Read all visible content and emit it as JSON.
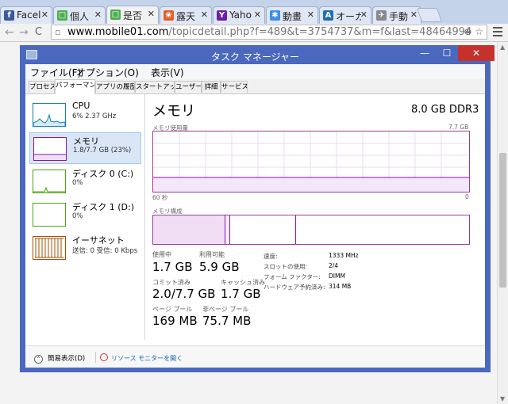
{
  "browser": {
    "tabs": [
      {
        "title": "Facel",
        "icon": "f",
        "color": "#3b5998"
      },
      {
        "title": "個人",
        "icon": "□",
        "color": "#4caf50"
      },
      {
        "title": "是否",
        "icon": "□",
        "color": "#4caf50"
      },
      {
        "title": "露天",
        "icon": "❀",
        "color": "#e0602a"
      },
      {
        "title": "Yaho",
        "icon": "Y",
        "color": "#6b1fa3"
      },
      {
        "title": "動畫",
        "icon": "✱",
        "color": "#3a8ee6"
      },
      {
        "title": "オーガ",
        "icon": "A",
        "color": "#1f6fb2"
      },
      {
        "title": "手動",
        "icon": "✈",
        "color": "#888888"
      }
    ],
    "close_glyph": "✕",
    "url_host": "www.mobile01.com",
    "url_path": "/topicdetail.php?f=489&t=3754737&m=f&last=48464994",
    "back_glyph": "←",
    "forward_glyph": "→",
    "reload_glyph": "C",
    "zoom_glyph": "⊕",
    "star_glyph": "☆",
    "page_glyph": "▫"
  },
  "taskmgr": {
    "title": "タスク マネージャー",
    "window_buttons": {
      "minimize": "—",
      "maximize": "☐",
      "close": "✕"
    },
    "menu": [
      "ファイル(F)",
      "オプション(O)",
      "表示(V)"
    ],
    "tabs": [
      "プロセス",
      "パフォーマンス",
      "アプリの履歴",
      "スタートアップ",
      "ユーザー",
      "詳細",
      "サービス"
    ],
    "resources": [
      {
        "name": "CPU",
        "sub": "6% 2.37 GHz",
        "color": "#117dbb"
      },
      {
        "name": "メモリ",
        "sub": "1.8/7.7 GB (23%)",
        "color": "#8b12ae"
      },
      {
        "name": "ディスク 0 (C:)",
        "sub": "0%",
        "color": "#4da60c"
      },
      {
        "name": "ディスク 1 (D:)",
        "sub": "0%",
        "color": "#4da60c"
      },
      {
        "name": "イーサネット",
        "sub": "送信: 0  受信: 0 Kbps",
        "color": "#a74f01"
      }
    ],
    "memory": {
      "title": "メモリ",
      "spec": "8.0 GB DDR3",
      "usage_label": "メモリ使用量",
      "usage_max": "7.7 GB",
      "axis_left": "60 秒",
      "axis_right": "0",
      "composition_label": "メモリ構成",
      "in_use_label": "使用中",
      "in_use": "1.7 GB",
      "available_label": "利用可能",
      "available": "5.9 GB",
      "committed_label": "コミット済み",
      "committed": "2.0/7.7 GB",
      "cached_label": "キャッシュ済み",
      "cached": "1.7 GB",
      "paged_label": "ページ プール",
      "paged": "169 MB",
      "nonpaged_label": "非ページ プール",
      "nonpaged": "75.7 MB",
      "speed_label": "速度:",
      "speed": "1333 MHz",
      "slots_label": "スロットの使用:",
      "slots": "2/4",
      "form_label": "フォーム ファクター:",
      "form": "DIMM",
      "reserved_label": "ハードウェア予約済み:",
      "reserved": "314 MB"
    },
    "fewer_details": "簡易表示(D)",
    "fewer_glyph": "⌃",
    "resource_monitor": "リソース モニターを開く"
  }
}
